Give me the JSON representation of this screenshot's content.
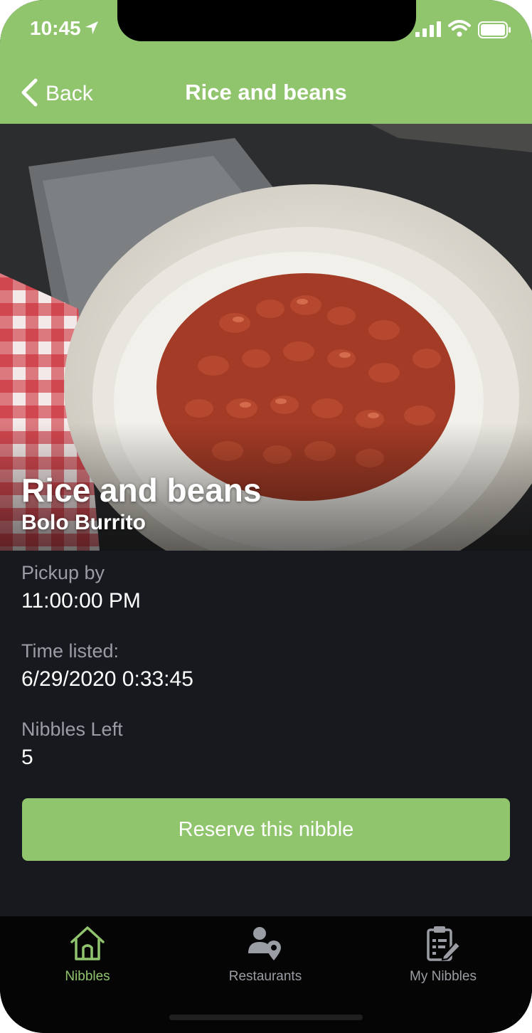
{
  "status_bar": {
    "time": "10:45"
  },
  "header": {
    "back_label": "Back",
    "title": "Rice and beans"
  },
  "hero": {
    "title": "Rice and beans",
    "subtitle": "Bolo Burrito"
  },
  "details": {
    "pickup_label": "Pickup by",
    "pickup_value": "11:00:00 PM",
    "listed_label": "Time listed:",
    "listed_value": "6/29/2020 0:33:45",
    "left_label": "Nibbles Left",
    "left_value": "5"
  },
  "reserve_button": {
    "label": "Reserve this nibble"
  },
  "tab_bar": {
    "tabs": [
      {
        "label": "Nibbles",
        "icon": "home-icon",
        "active": true
      },
      {
        "label": "Restaurants",
        "icon": "user-location-icon",
        "active": false
      },
      {
        "label": "My Nibbles",
        "icon": "clipboard-edit-icon",
        "active": false
      }
    ]
  },
  "colors": {
    "accent": "#90c56e",
    "background": "#17191e",
    "tab_bar": "#050505",
    "muted_text": "#9a9da3"
  }
}
